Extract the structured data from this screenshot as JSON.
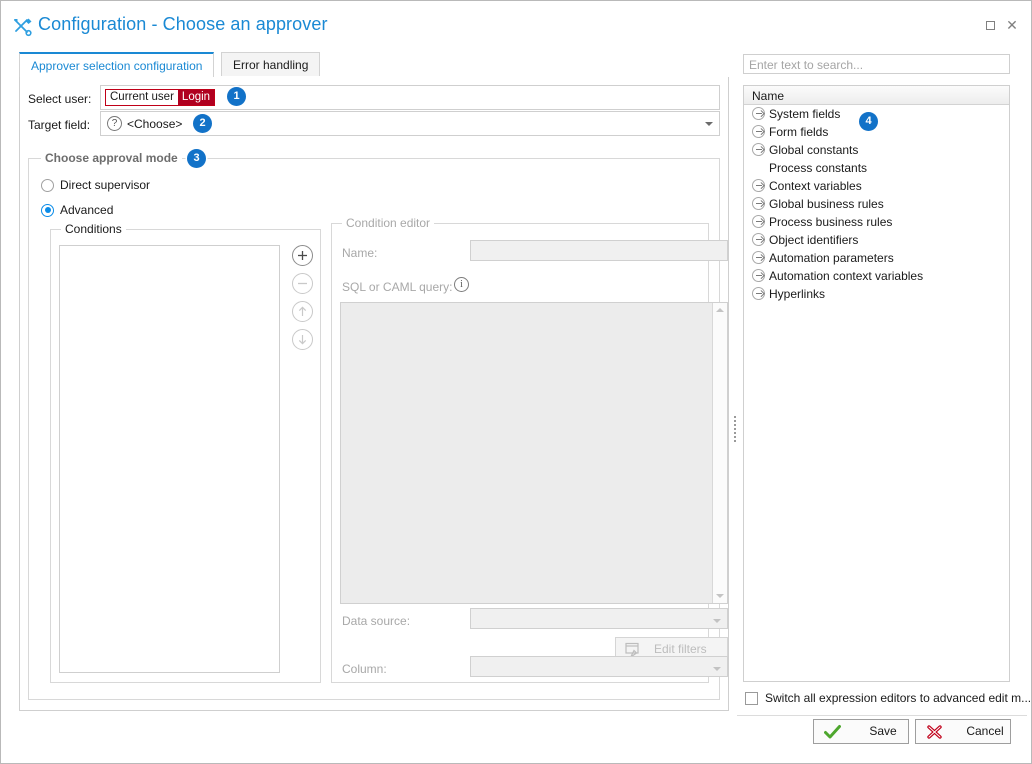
{
  "window": {
    "title": "Configuration - Choose an approver",
    "title_icon": "tools-icon",
    "maximize_label": "Maximize",
    "close_label": "Close"
  },
  "tabs": [
    {
      "label": "Approver selection configuration",
      "active": true
    },
    {
      "label": "Error handling",
      "active": false
    }
  ],
  "form": {
    "select_user_label": "Select user:",
    "select_user_tag_prefix": "Current user",
    "select_user_tag_suffix": "Login",
    "target_field_label": "Target field:",
    "target_field_value": "<Choose>",
    "target_field_icon": "question-icon"
  },
  "badges": {
    "one": "1",
    "two": "2",
    "three": "3",
    "four": "4"
  },
  "approval_mode": {
    "group_title": "Choose approval mode",
    "options": [
      {
        "label": "Direct supervisor",
        "selected": false
      },
      {
        "label": "Advanced",
        "selected": true
      }
    ]
  },
  "conditions": {
    "group_title": "Conditions",
    "items": [],
    "buttons": [
      {
        "name": "add",
        "glyph": "+",
        "enabled": true
      },
      {
        "name": "remove",
        "glyph": "−",
        "enabled": false
      },
      {
        "name": "move-up",
        "glyph": "↑",
        "enabled": false
      },
      {
        "name": "move-down",
        "glyph": "↓",
        "enabled": false
      }
    ]
  },
  "condition_editor": {
    "group_title": "Condition editor",
    "name_label": "Name:",
    "name_value": "",
    "query_label": "SQL or CAML query:",
    "query_info_icon": "info-icon",
    "query_value": "",
    "data_source_label": "Data source:",
    "data_source_value": "",
    "edit_filters_label": "Edit filters",
    "edit_filters_icon": "edit-filters-icon",
    "column_label": "Column:",
    "column_value": ""
  },
  "right_panel": {
    "search_placeholder": "Enter text to search...",
    "tree_header": "Name",
    "tree_items": [
      {
        "label": "System fields",
        "expandable": true
      },
      {
        "label": "Form fields",
        "expandable": true
      },
      {
        "label": "Global constants",
        "expandable": true
      },
      {
        "label": "Process constants",
        "expandable": false
      },
      {
        "label": "Context variables",
        "expandable": true
      },
      {
        "label": "Global business rules",
        "expandable": true
      },
      {
        "label": "Process business rules",
        "expandable": true
      },
      {
        "label": "Object identifiers",
        "expandable": true
      },
      {
        "label": "Automation parameters",
        "expandable": true
      },
      {
        "label": "Automation context variables",
        "expandable": true
      },
      {
        "label": "Hyperlinks",
        "expandable": true
      }
    ]
  },
  "footer": {
    "switch_checkbox_label": "Switch all expression editors to advanced edit m...",
    "switch_checked": false,
    "save_label": "Save",
    "save_icon": "green-check-icon",
    "cancel_label": "Cancel",
    "cancel_icon": "red-x-icon"
  },
  "colors": {
    "accent": "#1a89d4",
    "badge": "#1272c8",
    "tag_red": "#b00020",
    "save_green": "#4ea72e",
    "cancel_red": "#c0001a"
  }
}
